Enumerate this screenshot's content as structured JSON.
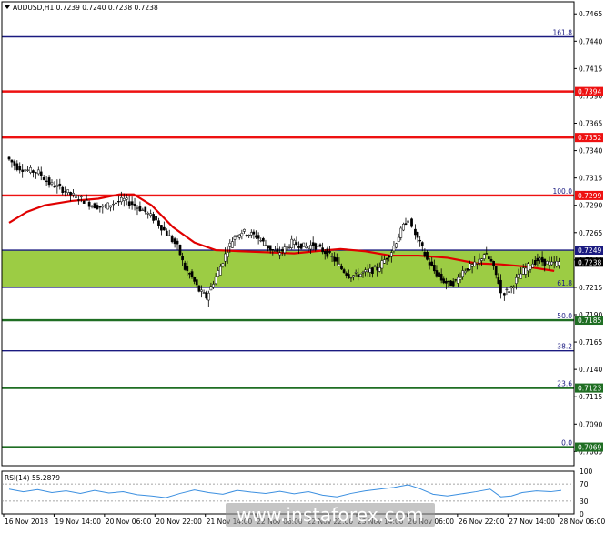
{
  "colors": {
    "background": "#ffffff",
    "frame": "#000000",
    "up_candle": "#000000",
    "down_candle": "#000000",
    "zone_fill": "#9ccc44",
    "red_level": "#ee1111",
    "blue_level": "#1a1a80",
    "green_level": "#1f6e23",
    "moving_average": "#e00000",
    "rsi_line": "#3b8fe0"
  },
  "chart_data": {
    "type": "candlestick",
    "title": "AUDUSD,H1  0.7239 0.7240 0.7238 0.7238",
    "symbol": "AUDUSD",
    "timeframe": "H1",
    "ohlc_header": "0.7239 0.7240 0.7238 0.7238",
    "ylim": [
      0.7052,
      0.7476
    ],
    "y_ticks": [
      "0.7465",
      "0.7440",
      "0.7415",
      "0.7390",
      "0.7365",
      "0.7340",
      "0.7315",
      "0.7290",
      "0.7265",
      "0.7240",
      "0.7215",
      "0.7190",
      "0.7165",
      "0.7140",
      "0.7115",
      "0.7090",
      "0.7065"
    ],
    "x_labels": [
      "16 Nov 2018",
      "19 Nov 14:00",
      "20 Nov 06:00",
      "20 Nov 22:00",
      "21 Nov 14:00",
      "22 Nov 06:00",
      "22 Nov 22:00",
      "23 Nov 14:00",
      "26 Nov 06:00",
      "26 Nov 22:00",
      "27 Nov 14:00",
      "28 Nov 06:00"
    ],
    "current_price": "0.7238",
    "support_zone": [
      0.7215,
      0.7249
    ],
    "levels": [
      {
        "value": 0.7444,
        "color": "blue",
        "fib_label": "161.8",
        "price_tag": ""
      },
      {
        "value": 0.7394,
        "color": "red",
        "fib_label": "",
        "price_tag": "0.7394"
      },
      {
        "value": 0.7352,
        "color": "red",
        "fib_label": "",
        "price_tag": "0.7352"
      },
      {
        "value": 0.7299,
        "color": "red",
        "fib_label": "100.0",
        "price_tag": "0.7299"
      },
      {
        "value": 0.7249,
        "color": "blue",
        "fib_label": "",
        "price_tag": "0.7249"
      },
      {
        "value": 0.7215,
        "color": "blue",
        "fib_label": "61.8",
        "price_tag": ""
      },
      {
        "value": 0.7185,
        "color": "green",
        "fib_label": "50.0",
        "price_tag": "0.7185"
      },
      {
        "value": 0.7157,
        "color": "blue",
        "fib_label": "38.2",
        "price_tag": ""
      },
      {
        "value": 0.7123,
        "color": "green",
        "fib_label": "23.6",
        "price_tag": "0.7123"
      },
      {
        "value": 0.7069,
        "color": "green",
        "fib_label": "0.0",
        "price_tag": "0.7069"
      }
    ],
    "price_path": [
      [
        0,
        0.7334
      ],
      [
        6,
        0.7325
      ],
      [
        12,
        0.7322
      ],
      [
        18,
        0.732
      ],
      [
        24,
        0.731
      ],
      [
        30,
        0.7306
      ],
      [
        36,
        0.73
      ],
      [
        42,
        0.7296
      ],
      [
        48,
        0.729
      ],
      [
        54,
        0.7288
      ],
      [
        60,
        0.7292
      ],
      [
        66,
        0.7295
      ],
      [
        72,
        0.729
      ],
      [
        78,
        0.7284
      ],
      [
        84,
        0.7276
      ],
      [
        90,
        0.7264
      ],
      [
        96,
        0.7252
      ],
      [
        100,
        0.7232
      ],
      [
        104,
        0.7224
      ],
      [
        108,
        0.7212
      ],
      [
        112,
        0.7206
      ],
      [
        116,
        0.722
      ],
      [
        120,
        0.7234
      ],
      [
        124,
        0.725
      ],
      [
        128,
        0.7262
      ],
      [
        132,
        0.7266
      ],
      [
        136,
        0.7264
      ],
      [
        140,
        0.7262
      ],
      [
        144,
        0.7256
      ],
      [
        148,
        0.725
      ],
      [
        152,
        0.7246
      ],
      [
        156,
        0.725
      ],
      [
        160,
        0.7256
      ],
      [
        164,
        0.7254
      ],
      [
        168,
        0.7252
      ],
      [
        172,
        0.7254
      ],
      [
        176,
        0.725
      ],
      [
        180,
        0.7246
      ],
      [
        184,
        0.724
      ],
      [
        188,
        0.7232
      ],
      [
        192,
        0.7226
      ],
      [
        196,
        0.7226
      ],
      [
        200,
        0.7228
      ],
      [
        204,
        0.723
      ],
      [
        208,
        0.7232
      ],
      [
        212,
        0.724
      ],
      [
        216,
        0.7248
      ],
      [
        220,
        0.7262
      ],
      [
        224,
        0.7275
      ],
      [
        226,
        0.7278
      ],
      [
        228,
        0.7268
      ],
      [
        232,
        0.7255
      ],
      [
        236,
        0.724
      ],
      [
        240,
        0.723
      ],
      [
        244,
        0.7222
      ],
      [
        248,
        0.7218
      ],
      [
        252,
        0.722
      ],
      [
        256,
        0.723
      ],
      [
        260,
        0.7234
      ],
      [
        264,
        0.7236
      ],
      [
        268,
        0.7246
      ],
      [
        272,
        0.7238
      ],
      [
        276,
        0.722
      ],
      [
        278,
        0.721
      ],
      [
        282,
        0.7212
      ],
      [
        286,
        0.7222
      ],
      [
        290,
        0.723
      ],
      [
        294,
        0.7236
      ],
      [
        298,
        0.724
      ],
      [
        302,
        0.7238
      ],
      [
        306,
        0.7236
      ],
      [
        310,
        0.7238
      ]
    ],
    "moving_average_path": [
      [
        0,
        0.7274
      ],
      [
        10,
        0.7284
      ],
      [
        20,
        0.729
      ],
      [
        35,
        0.7294
      ],
      [
        50,
        0.7296
      ],
      [
        62,
        0.73
      ],
      [
        70,
        0.73
      ],
      [
        80,
        0.729
      ],
      [
        92,
        0.727
      ],
      [
        104,
        0.7256
      ],
      [
        116,
        0.7249
      ],
      [
        130,
        0.7248
      ],
      [
        145,
        0.7247
      ],
      [
        160,
        0.7246
      ],
      [
        172,
        0.7248
      ],
      [
        186,
        0.725
      ],
      [
        200,
        0.7248
      ],
      [
        214,
        0.7244
      ],
      [
        230,
        0.7244
      ],
      [
        246,
        0.7242
      ],
      [
        262,
        0.7237
      ],
      [
        276,
        0.7236
      ],
      [
        290,
        0.7234
      ],
      [
        306,
        0.723
      ]
    ],
    "moving_average_label": "",
    "rsi": {
      "label": "RSI(14) 55.2879",
      "value": 55.2879,
      "ylim": [
        0,
        100
      ],
      "ticks": [
        "100",
        "70",
        "30",
        "0"
      ],
      "levels": [
        70,
        30
      ],
      "path": [
        [
          0,
          58
        ],
        [
          8,
          52
        ],
        [
          16,
          57
        ],
        [
          24,
          50
        ],
        [
          32,
          54
        ],
        [
          40,
          48
        ],
        [
          48,
          55
        ],
        [
          56,
          49
        ],
        [
          64,
          52
        ],
        [
          72,
          45
        ],
        [
          80,
          42
        ],
        [
          88,
          38
        ],
        [
          96,
          48
        ],
        [
          104,
          56
        ],
        [
          112,
          50
        ],
        [
          120,
          46
        ],
        [
          128,
          55
        ],
        [
          136,
          51
        ],
        [
          144,
          48
        ],
        [
          152,
          53
        ],
        [
          160,
          47
        ],
        [
          168,
          52
        ],
        [
          176,
          44
        ],
        [
          184,
          40
        ],
        [
          192,
          48
        ],
        [
          200,
          54
        ],
        [
          208,
          58
        ],
        [
          216,
          62
        ],
        [
          224,
          68
        ],
        [
          230,
          60
        ],
        [
          238,
          46
        ],
        [
          246,
          42
        ],
        [
          254,
          47
        ],
        [
          262,
          52
        ],
        [
          270,
          58
        ],
        [
          276,
          40
        ],
        [
          282,
          42
        ],
        [
          288,
          50
        ],
        [
          296,
          54
        ],
        [
          304,
          52
        ],
        [
          310,
          55
        ]
      ]
    }
  },
  "watermark": "www.instaforex.com"
}
